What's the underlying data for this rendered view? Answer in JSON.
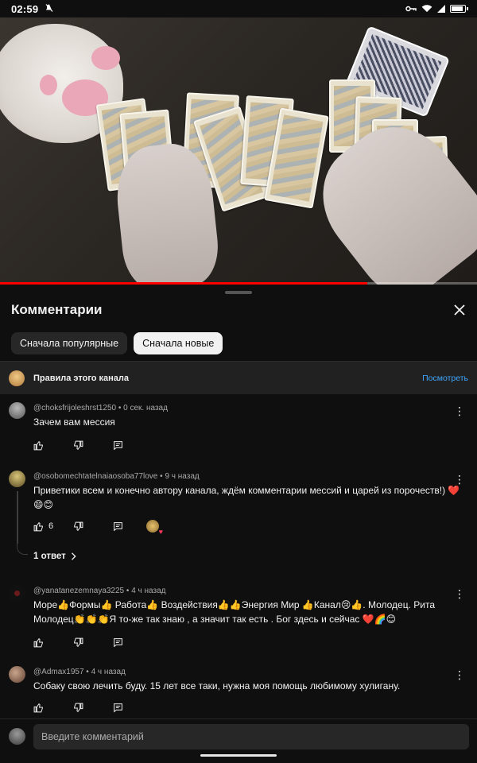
{
  "status_bar": {
    "time": "02:59",
    "battery_level": 0.9
  },
  "video": {
    "progress": 0.77,
    "progress_color": "#ff0000"
  },
  "comments_panel": {
    "title": "Комментарии",
    "sort_chips": [
      {
        "label": "Сначала популярные",
        "active": false
      },
      {
        "label": "Сначала новые",
        "active": true
      }
    ],
    "rules_banner": {
      "label": "Правила этого канала",
      "link": "Посмотреть"
    },
    "comments": [
      {
        "author": "@choksfrijoleshrst1250",
        "time": "0 сек. назад",
        "text": "Зачем вам мессия",
        "likes": "",
        "avatar_color": "#8a8a8a"
      },
      {
        "author": "@osobomechtatelnaiaosoba77love",
        "time": "9 ч назад",
        "text": "Приветики всем и конечно автору канала, ждём комментарии мессий и царей из порочеств!) ❤️😄😊",
        "likes": "6",
        "avatar_color": "#8d7a4a",
        "replies_label": "1 ответ"
      },
      {
        "author": "@yanatanezemnaya3225",
        "time": "4 ч назад",
        "text": "Море👍Формы👍 Работа👍 Воздействия👍👍Энергия Мир 👍Канал😢👍. Молодец. Рита Молодец👏👏👏Я то-же так знаю , а значит так есть  . Бог здесь и сейчас ❤️🌈😊",
        "likes": "",
        "avatar_color": "#222222"
      },
      {
        "author": "@Admax1957",
        "time": "4 ч назад",
        "text": "Собаку свою лечить буду. 15 лет все таки, нужна моя помощь любимому хулигану.",
        "likes": "",
        "avatar_color": "#9b7560"
      }
    ],
    "input_placeholder": "Введите комментарий",
    "accent_link_color": "#3ea6ff"
  }
}
